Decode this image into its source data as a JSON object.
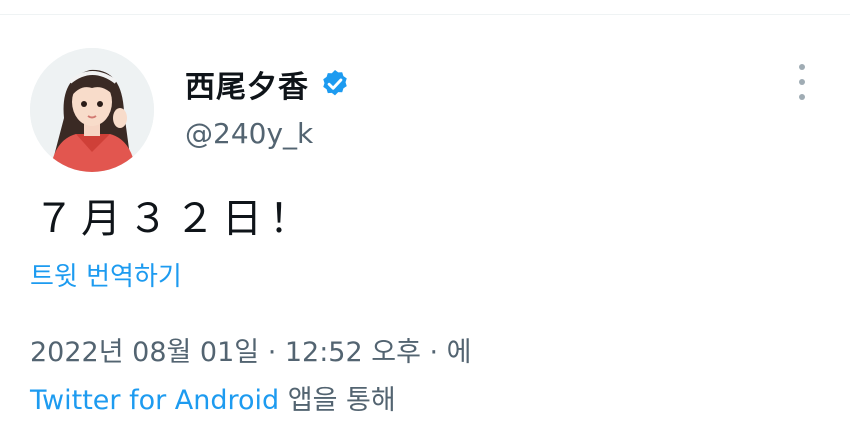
{
  "tweet": {
    "author_name": "西尾夕香",
    "handle": "@240y_k",
    "text": "７月３２日！",
    "translate_label": "트윗 번역하기",
    "timestamp": "2022년 08월 01일 · 12:52 오후 · 에",
    "source_app": "Twitter for Android",
    "source_suffix": " 앱을 통해"
  },
  "icons": {
    "verified": "verified-badge-icon",
    "more": "more-vertical-icon"
  },
  "colors": {
    "accent": "#1d9bf0",
    "text": "#0f1419",
    "secondary": "#536471"
  }
}
